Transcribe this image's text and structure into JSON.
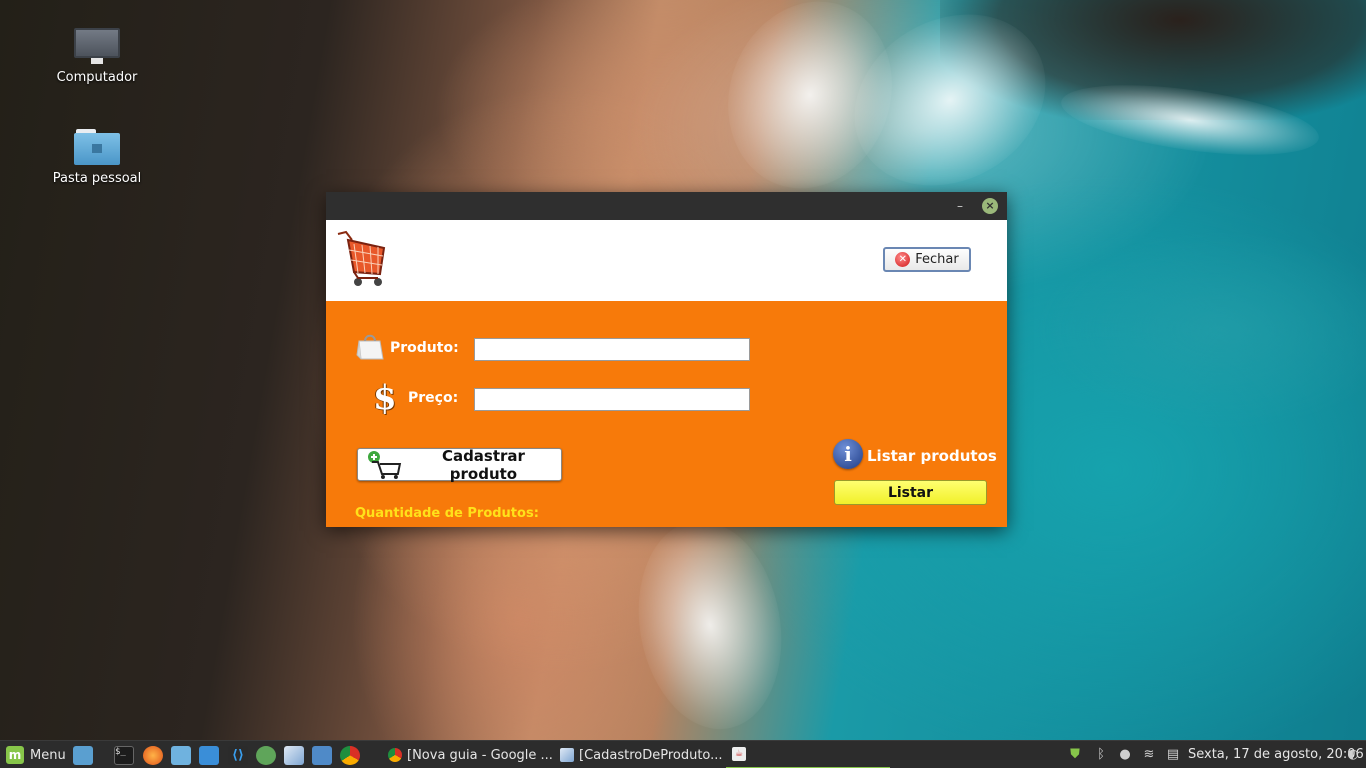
{
  "desktop": {
    "icons": [
      {
        "label": "Computador",
        "icon": "computer-icon"
      },
      {
        "label": "Pasta pessoal",
        "icon": "home-folder-icon"
      }
    ]
  },
  "window": {
    "minimize_glyph": "–",
    "close_glyph": "×",
    "close_button_label": "Fechar",
    "produto_label": "Produto:",
    "produto_value": "",
    "preco_label": "Preço:",
    "preco_value": "",
    "cadastrar_label": "Cadastrar produto",
    "listar_title": "Listar produtos",
    "listar_label": "Listar",
    "quantidade_label": "Quantidade de Produtos:",
    "colors": {
      "panel": "#f77a0a",
      "listar_button": "#ffff55",
      "quantidade_text": "#ffe11a"
    }
  },
  "taskbar": {
    "menu_label": "Menu",
    "launchers": [
      "show-desktop-icon",
      "terminal-icon",
      "firefox-icon",
      "files-icon",
      "text-editor-icon",
      "vscode-icon",
      "atom-icon",
      "package-icon",
      "screenshot-icon",
      "chrome-icon"
    ],
    "tasks": [
      {
        "label": "[Nova guia - Google ...",
        "icon": "chrome-icon"
      },
      {
        "label": "[CadastroDeProduto...",
        "icon": "package-icon"
      },
      {
        "label": "",
        "icon": "java-icon"
      }
    ],
    "tray": [
      "shield-icon",
      "bluetooth-icon",
      "user-icon",
      "wifi-icon",
      "clipboard-icon"
    ],
    "clock": "Sexta, 17 de agosto, 20:06"
  }
}
